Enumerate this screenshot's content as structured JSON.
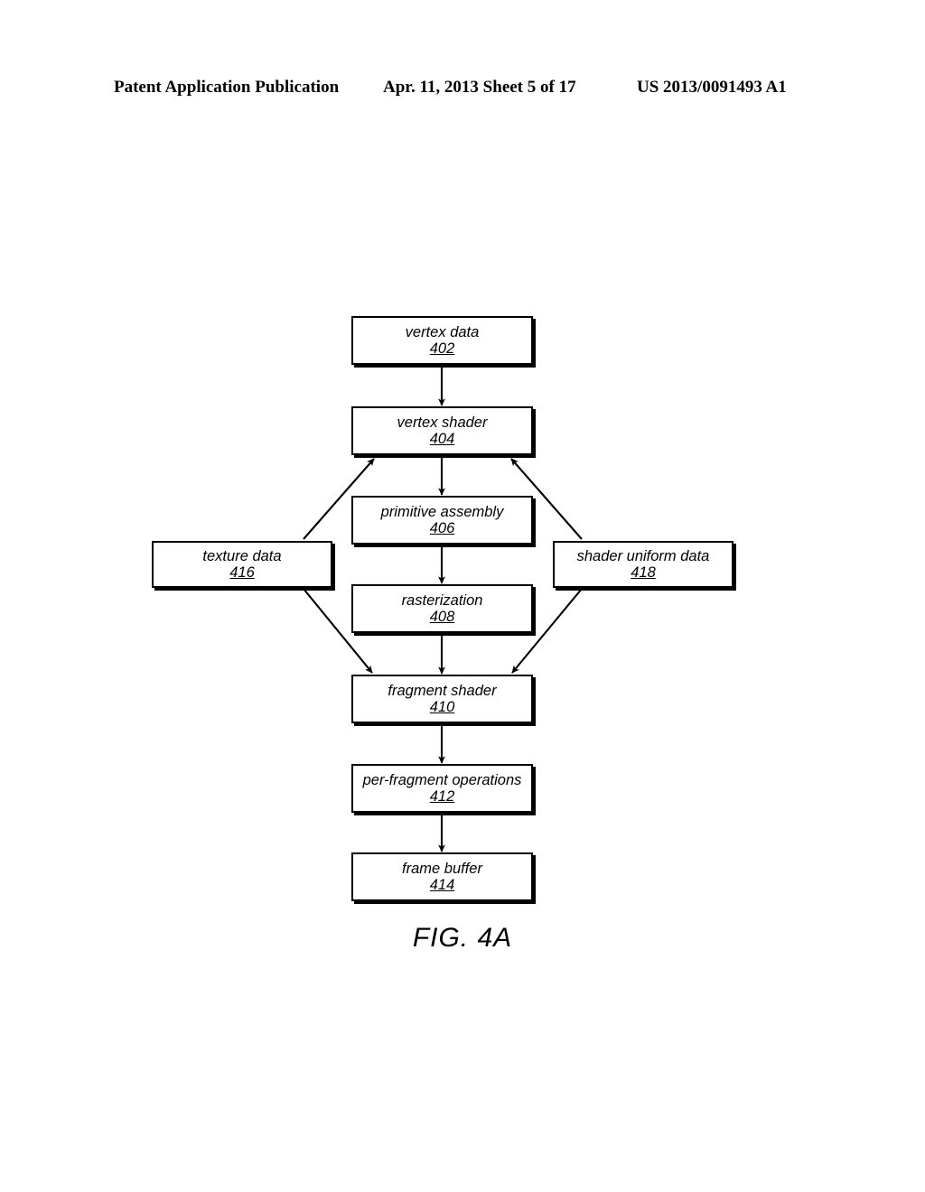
{
  "header": {
    "left": "Patent Application Publication",
    "middle": "Apr. 11, 2013  Sheet 5 of 17",
    "right": "US 2013/0091493 A1"
  },
  "figure": {
    "caption": "FIG. 4A",
    "nodes": [
      {
        "id": "vertex-data",
        "label": "vertex data",
        "ref": "402"
      },
      {
        "id": "vertex-shader",
        "label": "vertex shader",
        "ref": "404"
      },
      {
        "id": "primitive-assembly",
        "label": "primitive assembly",
        "ref": "406"
      },
      {
        "id": "rasterization",
        "label": "rasterization",
        "ref": "408"
      },
      {
        "id": "fragment-shader",
        "label": "fragment shader",
        "ref": "410"
      },
      {
        "id": "per-fragment-operations",
        "label": "per-fragment operations",
        "ref": "412"
      },
      {
        "id": "frame-buffer",
        "label": "frame buffer",
        "ref": "414"
      },
      {
        "id": "texture-data",
        "label": "texture data",
        "ref": "416"
      },
      {
        "id": "shader-uniform-data",
        "label": "shader uniform data",
        "ref": "418"
      }
    ],
    "edges": [
      {
        "from": "vertex-data",
        "to": "vertex-shader",
        "style": "straight-down"
      },
      {
        "from": "vertex-shader",
        "to": "primitive-assembly",
        "style": "straight-down"
      },
      {
        "from": "primitive-assembly",
        "to": "rasterization",
        "style": "straight-down"
      },
      {
        "from": "rasterization",
        "to": "fragment-shader",
        "style": "straight-down"
      },
      {
        "from": "fragment-shader",
        "to": "per-fragment-operations",
        "style": "straight-down"
      },
      {
        "from": "per-fragment-operations",
        "to": "frame-buffer",
        "style": "straight-down"
      },
      {
        "from": "texture-data",
        "to": "vertex-shader",
        "style": "diagonal-up-right"
      },
      {
        "from": "texture-data",
        "to": "fragment-shader",
        "style": "diagonal-down-right"
      },
      {
        "from": "shader-uniform-data",
        "to": "vertex-shader",
        "style": "diagonal-up-left"
      },
      {
        "from": "shader-uniform-data",
        "to": "fragment-shader",
        "style": "diagonal-down-left"
      }
    ]
  },
  "colors": {
    "ink": "#000000",
    "paper": "#ffffff"
  }
}
